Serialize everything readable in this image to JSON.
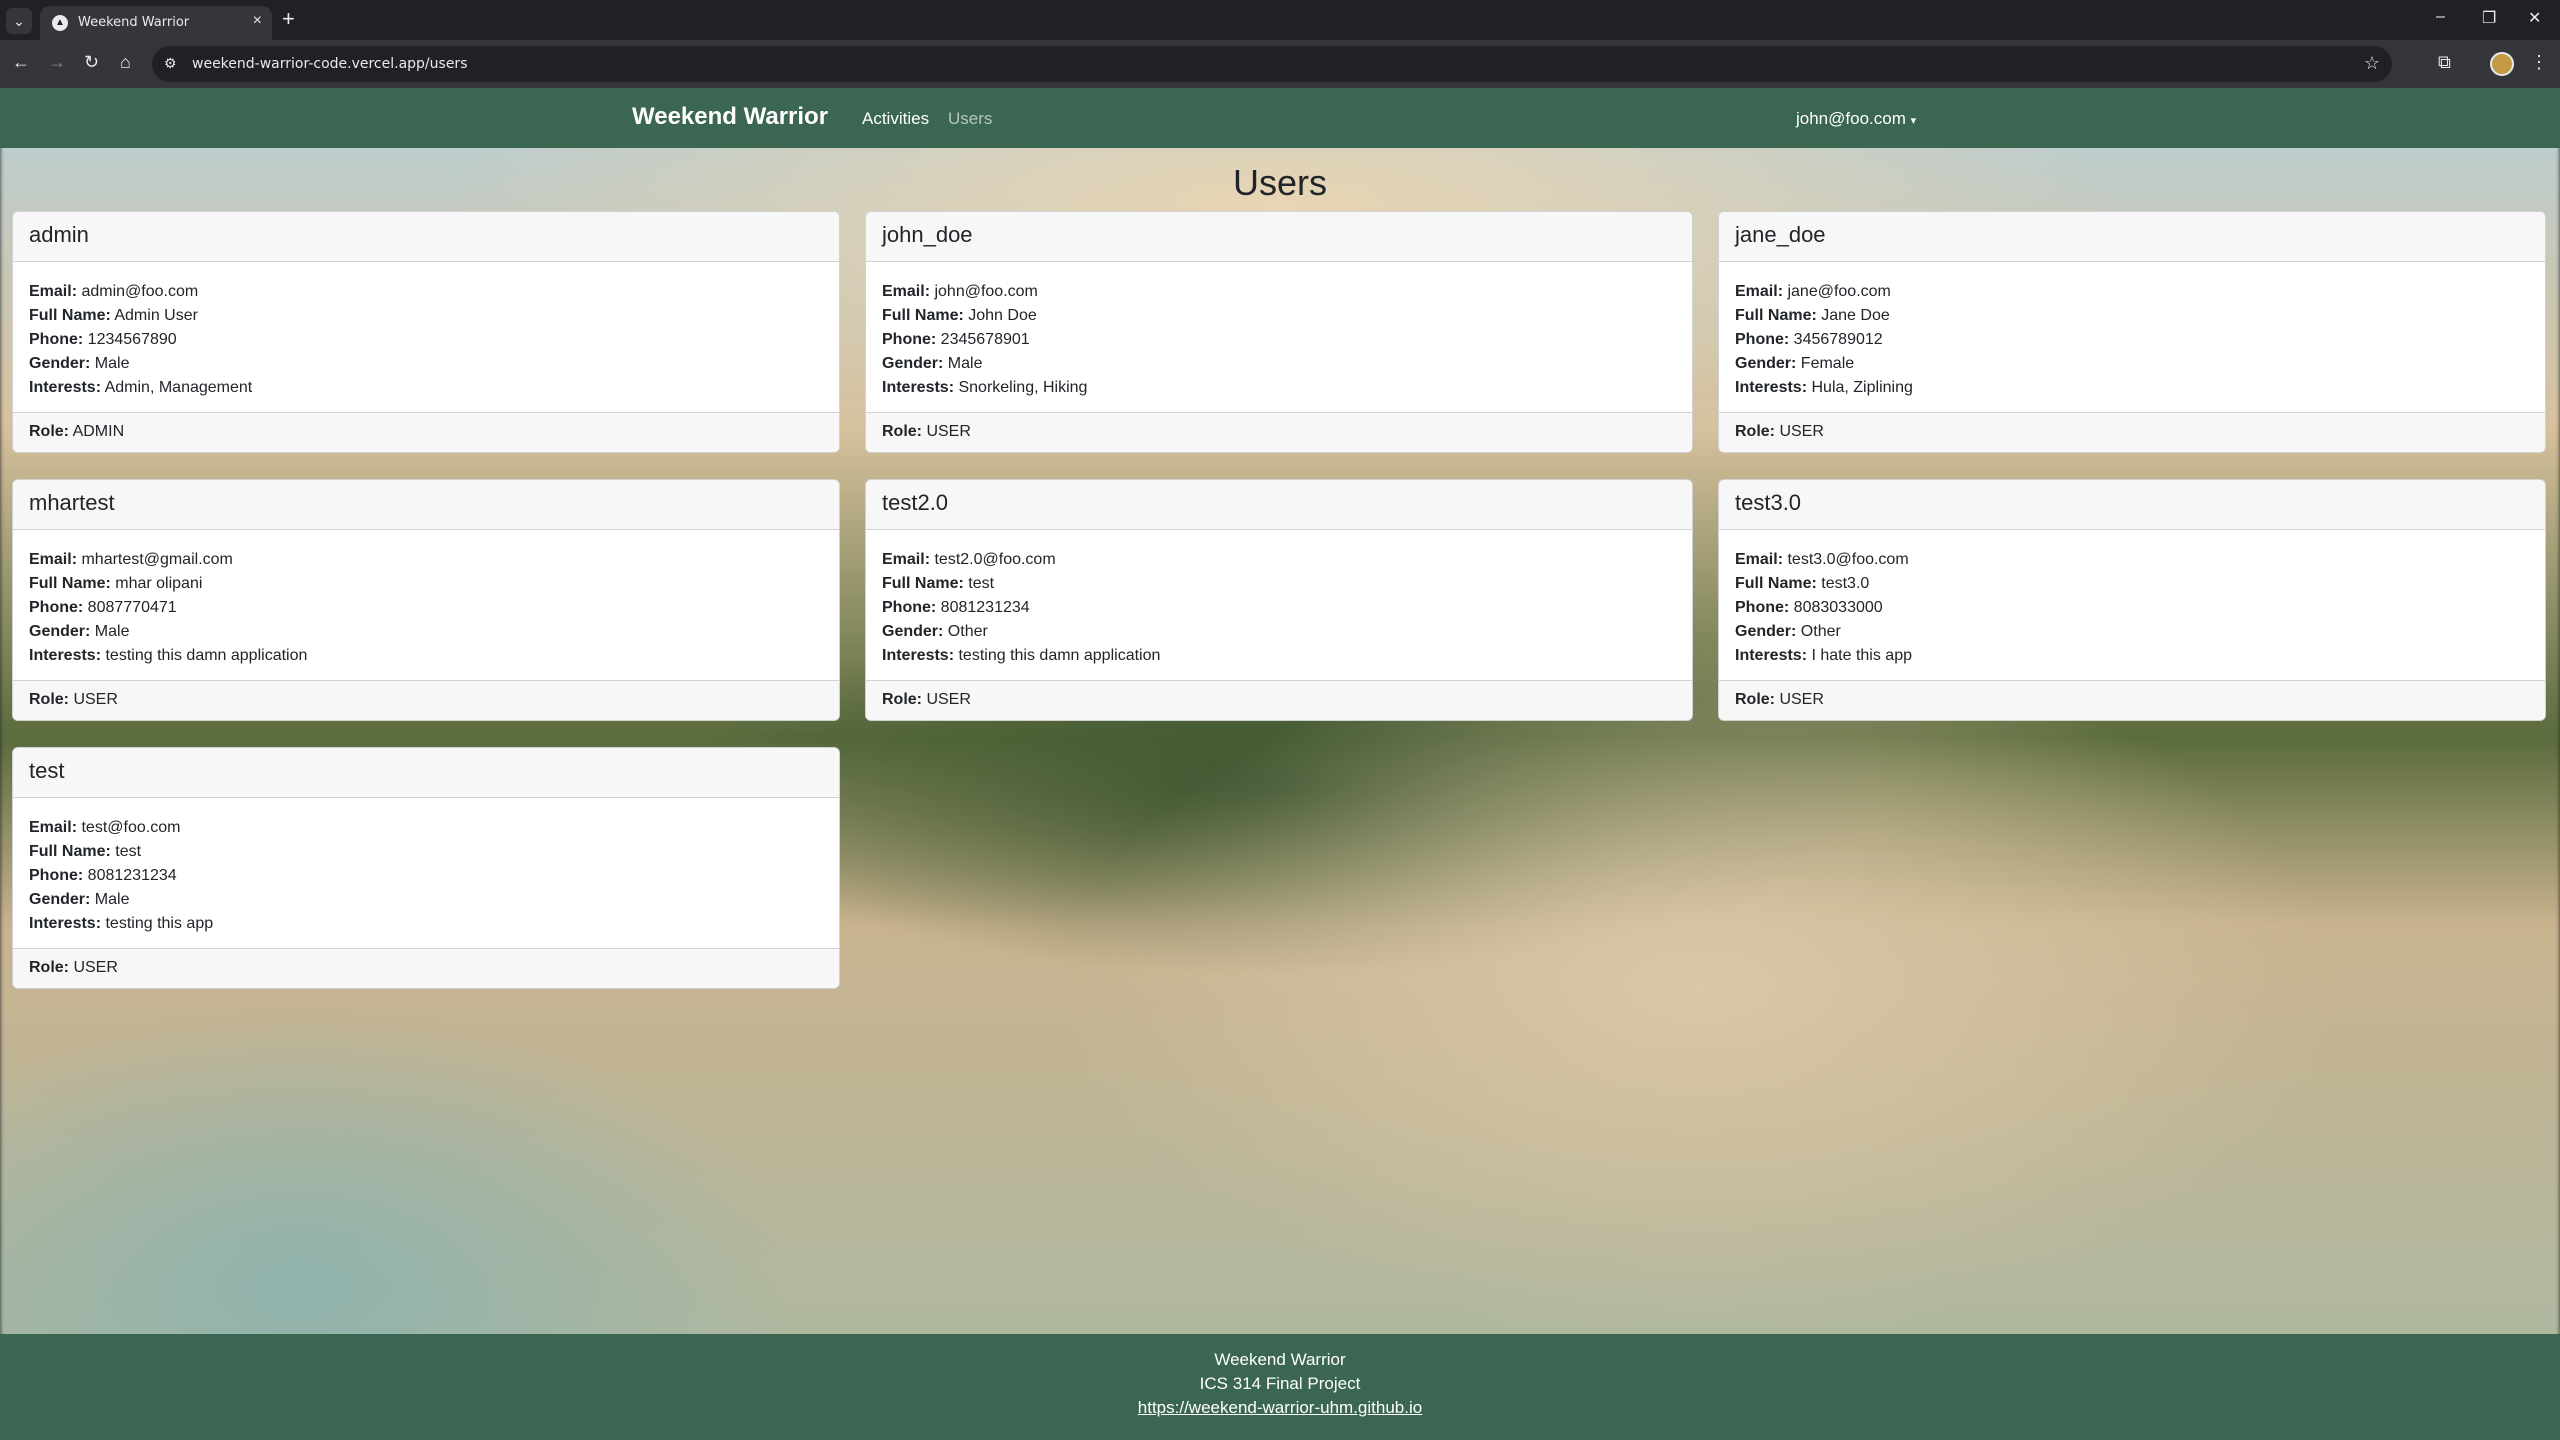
{
  "browser": {
    "tab_title": "Weekend Warrior",
    "url": "weekend-warrior-code.vercel.app/users"
  },
  "navbar": {
    "brand": "Weekend Warrior",
    "links": [
      "Activities",
      "Users"
    ],
    "user": "john@foo.com"
  },
  "page": {
    "title": "Users"
  },
  "labels": {
    "email": "Email:",
    "full_name": "Full Name:",
    "phone": "Phone:",
    "gender": "Gender:",
    "interests": "Interests:",
    "role": "Role:"
  },
  "users": [
    {
      "username": "admin",
      "email": "admin@foo.com",
      "full_name": "Admin User",
      "phone": "1234567890",
      "gender": "Male",
      "interests": "Admin, Management",
      "role": "ADMIN"
    },
    {
      "username": "john_doe",
      "email": "john@foo.com",
      "full_name": "John Doe",
      "phone": "2345678901",
      "gender": "Male",
      "interests": "Snorkeling, Hiking",
      "role": "USER"
    },
    {
      "username": "jane_doe",
      "email": "jane@foo.com",
      "full_name": "Jane Doe",
      "phone": "3456789012",
      "gender": "Female",
      "interests": "Hula, Ziplining",
      "role": "USER"
    },
    {
      "username": "mhartest",
      "email": "mhartest@gmail.com",
      "full_name": "mhar olipani",
      "phone": "8087770471",
      "gender": "Male",
      "interests": "testing this damn application",
      "role": "USER"
    },
    {
      "username": "test2.0",
      "email": "test2.0@foo.com",
      "full_name": "test",
      "phone": "8081231234",
      "gender": "Other",
      "interests": "testing this damn application",
      "role": "USER"
    },
    {
      "username": "test3.0",
      "email": "test3.0@foo.com",
      "full_name": "test3.0",
      "phone": "8083033000",
      "gender": "Other",
      "interests": "I hate this app",
      "role": "USER"
    },
    {
      "username": "test",
      "email": "test@foo.com",
      "full_name": "test",
      "phone": "8081231234",
      "gender": "Male",
      "interests": "testing this app",
      "role": "USER"
    }
  ],
  "footer": {
    "line1": "Weekend Warrior",
    "line2": "ICS 314 Final Project",
    "link": "https://weekend-warrior-uhm.github.io"
  }
}
